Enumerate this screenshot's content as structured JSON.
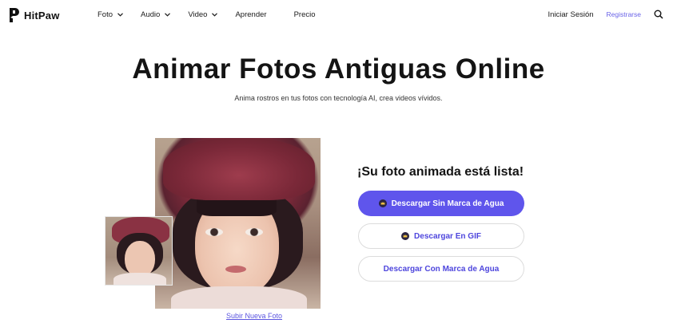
{
  "header": {
    "logo_text": "HitPaw",
    "nav": [
      {
        "label": "Foto",
        "has_dropdown": true
      },
      {
        "label": "Audio",
        "has_dropdown": true
      },
      {
        "label": "Video",
        "has_dropdown": true
      },
      {
        "label": "Aprender",
        "has_dropdown": false
      },
      {
        "label": "Precio",
        "has_dropdown": false
      }
    ],
    "login_label": "Iniciar Sesión",
    "register_label": "Registrarse"
  },
  "hero": {
    "title": "Animar Fotos Antiguas Online",
    "subtitle": "Anima rostros en tus fotos con tecnología AI, crea videos vívidos."
  },
  "result": {
    "ready_title": "¡Su foto animada está lista!",
    "download_no_watermark_label": "Descargar Sin Marca de Agua",
    "download_gif_label": "Descargar En GIF",
    "download_with_watermark_label": "Descargar Con Marca de Agua",
    "upload_new_label": "Subir Nueva Foto"
  },
  "colors": {
    "accent": "#5f55ec",
    "link": "#5b55e0",
    "register": "#6a63e8",
    "crown_badge": "#2b2540"
  },
  "icons": {
    "logo": "hitpaw-logo-icon",
    "search": "search-icon",
    "dropdown": "chevron-down-icon",
    "premium": "crown-icon"
  }
}
